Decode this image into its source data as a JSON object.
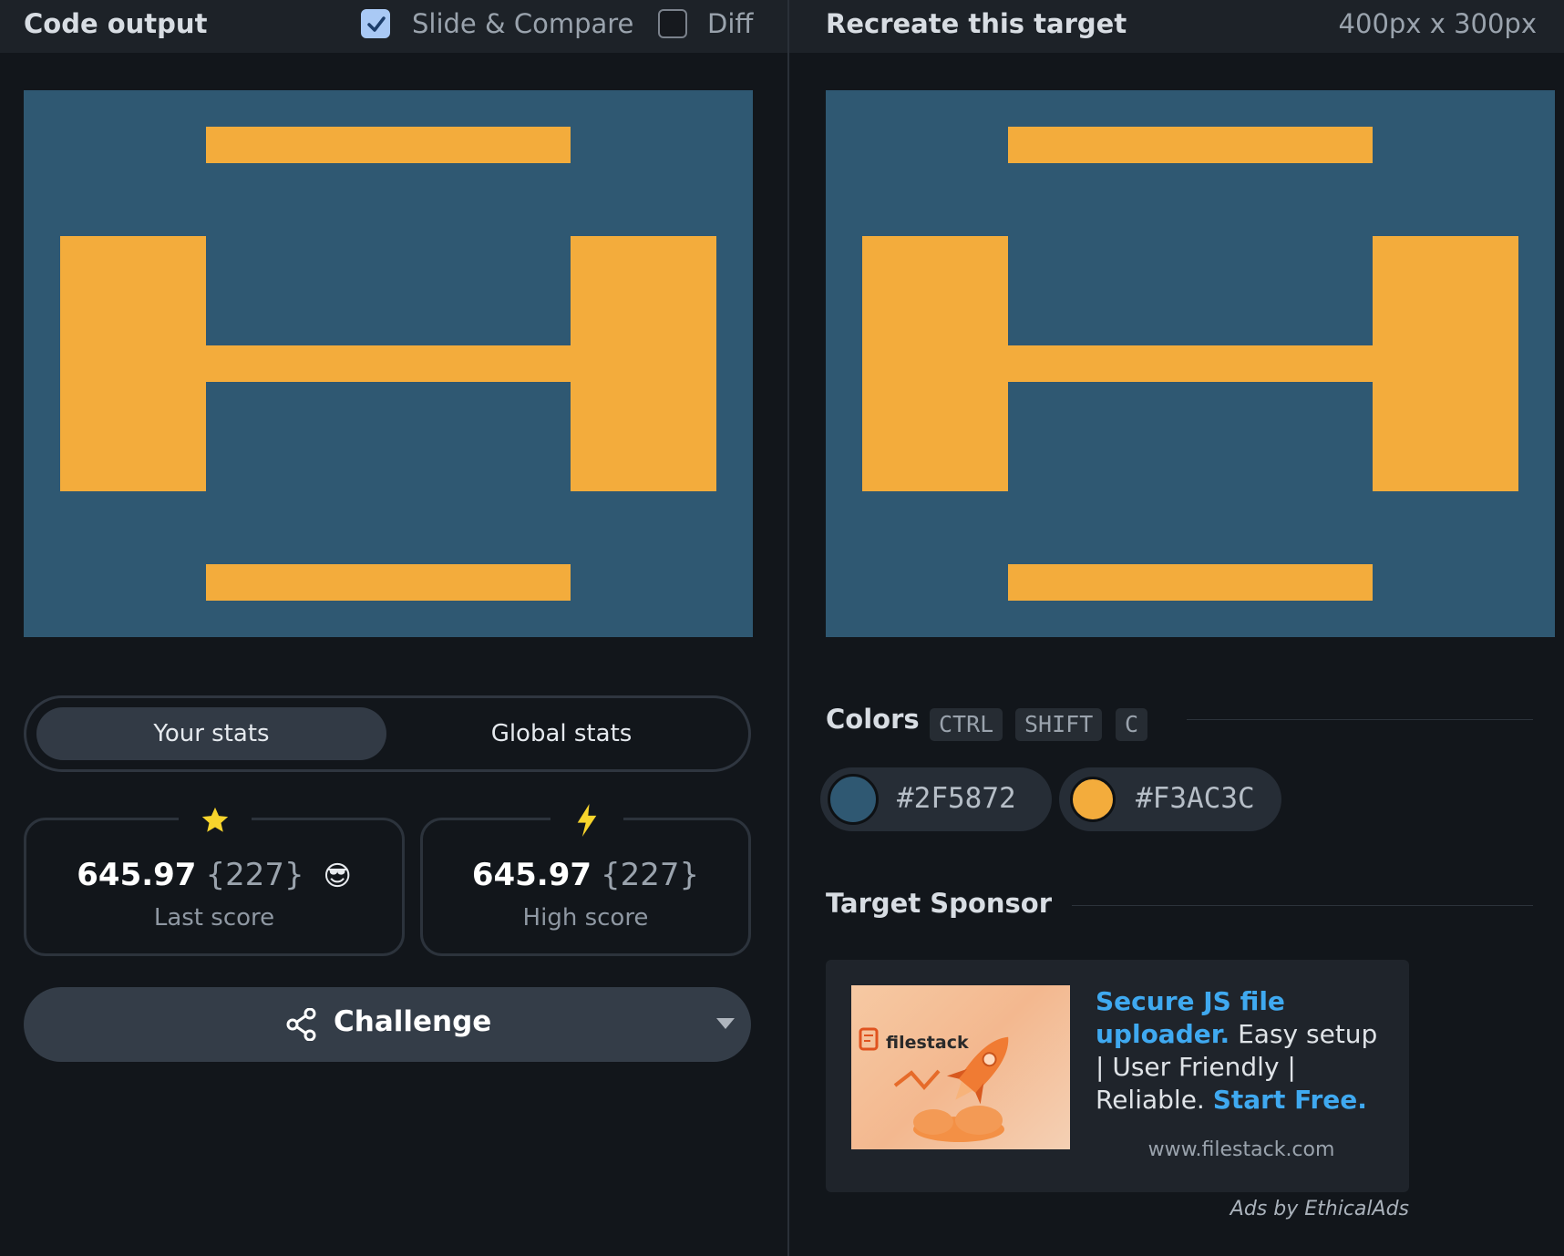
{
  "left": {
    "title": "Code output",
    "slide_compare_label": "Slide & Compare",
    "diff_label": "Diff"
  },
  "right": {
    "title": "Recreate this target",
    "dimensions": "400px x 300px"
  },
  "canvas": {
    "background": "#2F5872",
    "foreground": "#F3AC3C"
  },
  "stats": {
    "tab_your": "Your stats",
    "tab_global": "Global stats",
    "last": {
      "value": "645.97",
      "count": "{227}",
      "label": "Last score",
      "emoji": "😎"
    },
    "high": {
      "value": "645.97",
      "count": "{227}",
      "label": "High score"
    }
  },
  "challenge": {
    "label": "Challenge"
  },
  "colors": {
    "title": "Colors",
    "shortcut": [
      "CTRL",
      "SHIFT",
      "C"
    ],
    "swatches": [
      {
        "hex": "#2F5872"
      },
      {
        "hex": "#F3AC3C"
      }
    ]
  },
  "sponsor": {
    "title": "Target Sponsor",
    "brand": "filestack",
    "headline": "Secure JS file uploader.",
    "body": " Easy setup | User Friendly | Reliable. ",
    "cta": "Start Free.",
    "url": "www.filestack.com",
    "ads_by": "Ads by EthicalAds"
  }
}
